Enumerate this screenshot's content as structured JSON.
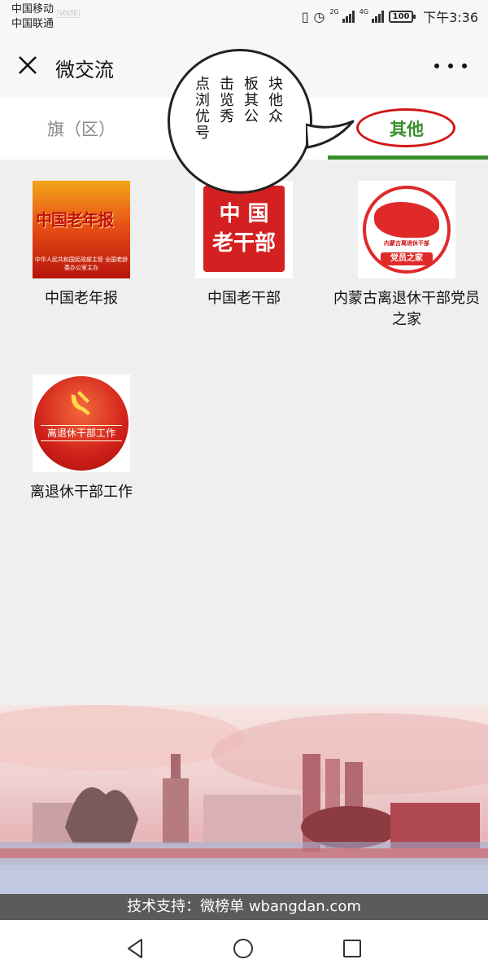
{
  "status_bar": {
    "carrier_1": "中国移动",
    "carrier_2": "中国联通",
    "badge": "VOLTE",
    "net_1": "2G",
    "net_2": "4G",
    "battery": "100",
    "time": "下午3:36"
  },
  "header": {
    "title": "微交流",
    "close_icon": "close-icon",
    "more_icon": "more-icon"
  },
  "tabs": [
    {
      "label": "旗（区）"
    },
    {
      "label": ""
    },
    {
      "label": "其他",
      "active": true
    }
  ],
  "annotation": {
    "columns": [
      "块他众",
      "板其公",
      "击览秀",
      "点浏优号"
    ]
  },
  "accounts": [
    {
      "name": "中国老年报",
      "thumb_title": "中国老年报",
      "thumb_sub": "中华人民共和国民政部主管 全国老龄委办公室主办"
    },
    {
      "name": "中国老干部",
      "thumb_line1": "中 国",
      "thumb_line2": "老干部"
    },
    {
      "name": "内蒙古离退休干部党员之家",
      "thumb_ribbon": "内蒙古离退休干部",
      "thumb_band": "党员之家"
    },
    {
      "name": "离退休干部工作",
      "thumb_label": "离退休干部工作"
    }
  ],
  "footer": {
    "credit": "技术支持：微榜单 wbangdan.com"
  },
  "nav": {
    "back": "back-icon",
    "home": "home-icon",
    "recents": "recents-icon"
  },
  "colors": {
    "accent_green": "#3a8f2c",
    "highlight_red": "#d11616"
  }
}
